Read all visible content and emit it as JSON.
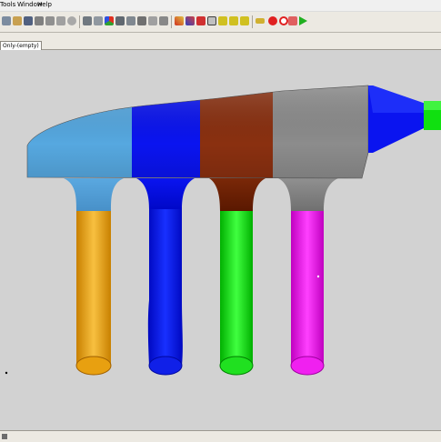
{
  "menu": {
    "tools": "Tools",
    "window": "Window",
    "help": "Help"
  },
  "toolbar": {
    "icons": [
      "new-icon",
      "open-icon",
      "save-icon",
      "print-icon",
      "cut-icon",
      "copy-icon",
      "paste-icon",
      "zoom-icon",
      "fit-icon",
      "rotate-icon",
      "pan-icon",
      "wireframe-icon",
      "shaded-icon",
      "color-map-icon",
      "view-icon",
      "mesh-icon",
      "probe-icon",
      "rectangle-select-icon",
      "delete-icon",
      "cross-icon",
      "cursor-icon",
      "arrow-left-icon",
      "arrow-right-icon",
      "arrow-up-icon",
      "key-icon",
      "stop-icon",
      "no-entry-icon",
      "grid-icon",
      "play-icon"
    ]
  },
  "tabs": {
    "active_label": "Only-(empty)"
  },
  "colors": {
    "light_blue": "#56a8e0",
    "blue": "#0a14f0",
    "brown": "#8a3010",
    "gray": "#8c8c8c",
    "orange": "#f0a800",
    "green": "#10e010",
    "magenta": "#f000f0",
    "background": "#d2d2d2"
  }
}
